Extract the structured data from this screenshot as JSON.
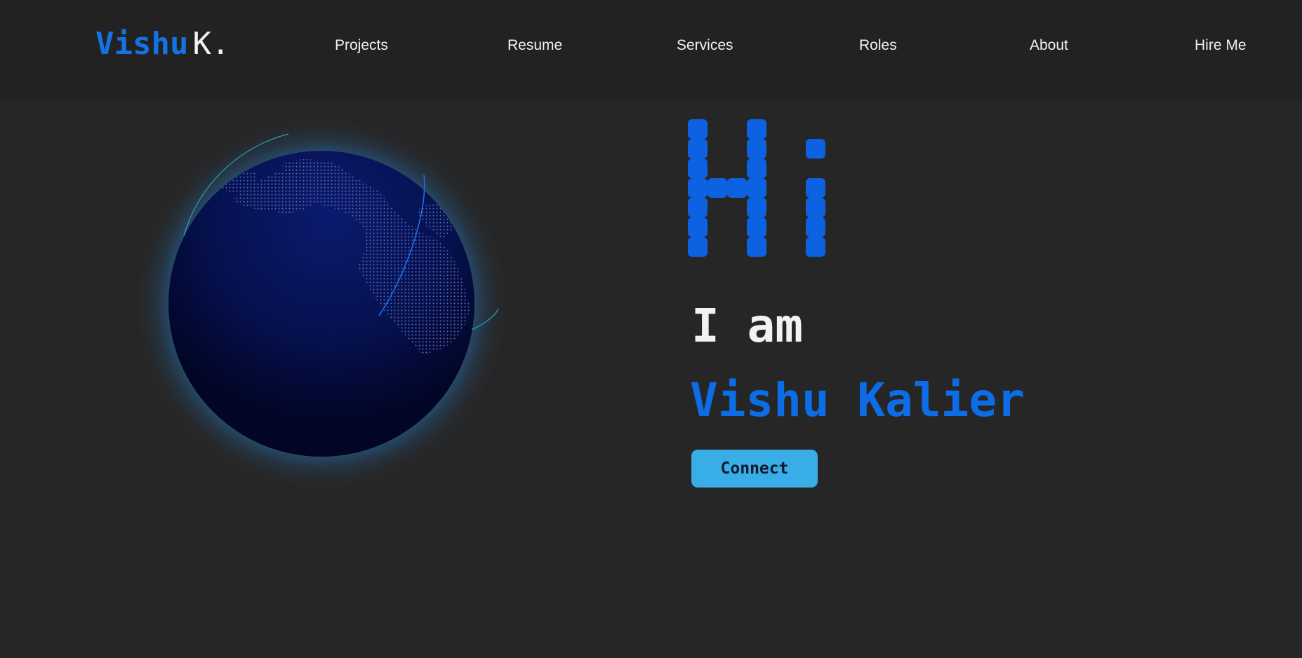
{
  "logo": {
    "first": "Vishu",
    "last": "K."
  },
  "nav": {
    "projects": "Projects",
    "resume": "Resume",
    "services": "Services",
    "roles": "Roles",
    "about": "About",
    "hire": "Hire Me"
  },
  "hero": {
    "greeting": "Hi",
    "intro": "I am",
    "name": "Vishu Kalier",
    "cta": "Connect"
  },
  "colors": {
    "accent": "#1472e3",
    "greeting_dots": "#0d62e1",
    "button": "#38ade6",
    "nav_background": "#222222",
    "page_background": "#262626",
    "globe": "#050a3a"
  },
  "icons": {
    "globe": "globe-icon"
  }
}
